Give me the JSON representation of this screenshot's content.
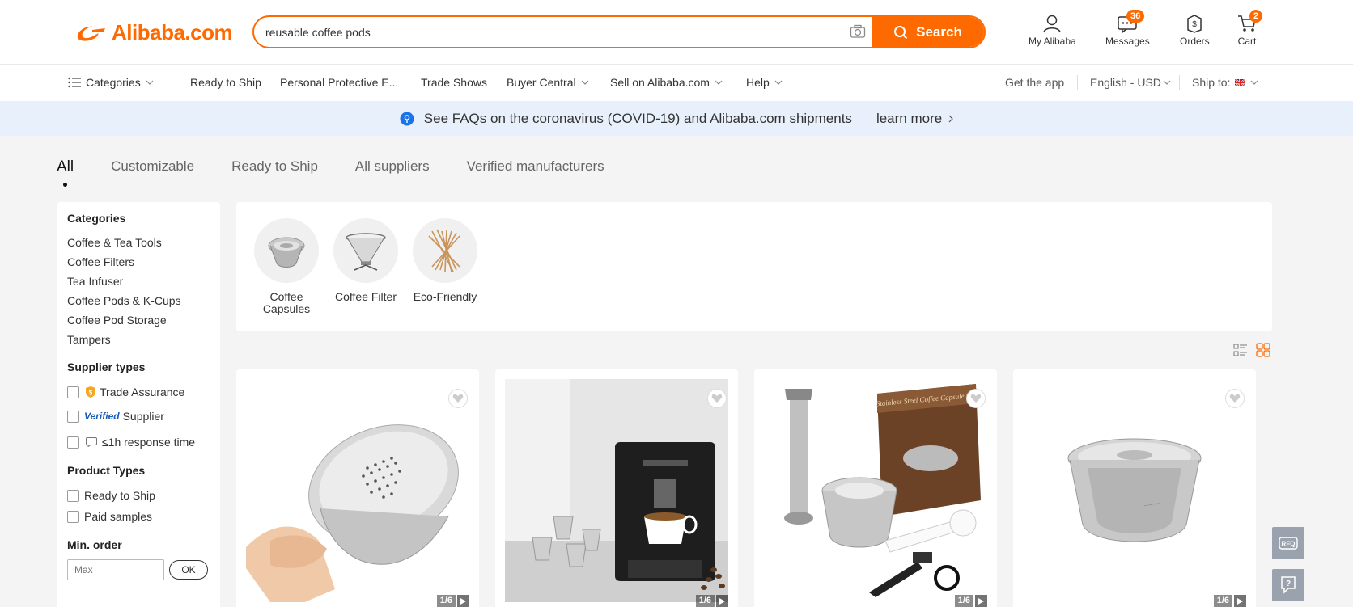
{
  "header": {
    "logo": "Alibaba.com",
    "search": {
      "value": "reusable coffee pods",
      "button": "Search"
    },
    "items": {
      "my_alibaba": "My Alibaba",
      "messages": "Messages",
      "messages_badge": "36",
      "orders": "Orders",
      "cart": "Cart",
      "cart_badge": "2"
    }
  },
  "nav": {
    "categories": "Categories",
    "ready_to_ship": "Ready to Ship",
    "ppe": "Personal Protective E...",
    "trade_shows": "Trade Shows",
    "buyer_central": "Buyer Central",
    "sell": "Sell on Alibaba.com",
    "help": "Help",
    "get_app": "Get the app",
    "language": "English - USD",
    "ship_to": "Ship to:"
  },
  "notice": {
    "text": "See FAQs on the coronavirus (COVID-19) and Alibaba.com shipments",
    "link": "learn more"
  },
  "tabs": [
    "All",
    "Customizable",
    "Ready to Ship",
    "All suppliers",
    "Verified manufacturers"
  ],
  "sidebar": {
    "categories_title": "Categories",
    "categories": [
      "Coffee & Tea Tools",
      "Coffee Filters",
      "Tea Infuser",
      "Coffee Pods & K-Cups",
      "Coffee Pod Storage",
      "Tampers"
    ],
    "supplier_types_title": "Supplier types",
    "trade_assurance": "Trade Assurance",
    "verified_badge": "Verified",
    "verified_supplier": "Supplier",
    "response_time": "≤1h response time",
    "product_types_title": "Product Types",
    "ready_to_ship": "Ready to Ship",
    "paid_samples": "Paid samples",
    "min_order_title": "Min. order",
    "min_placeholder": "Max",
    "ok": "OK"
  },
  "chips": [
    {
      "label": "Coffee Capsules"
    },
    {
      "label": "Coffee Filter"
    },
    {
      "label": "Eco-Friendly"
    }
  ],
  "products": [
    {
      "counter": "1/6"
    },
    {
      "counter": "1/6"
    },
    {
      "counter": "1/6"
    },
    {
      "counter": "1/6"
    }
  ],
  "product_box_text": [
    "Stainless Steel Coffee Capsule Set"
  ],
  "floating": {
    "rfq": "RFQ"
  },
  "colors": {
    "brand": "#ff6a00",
    "notice_bg": "#e8f1fb",
    "page_bg": "#f4f4f4"
  }
}
